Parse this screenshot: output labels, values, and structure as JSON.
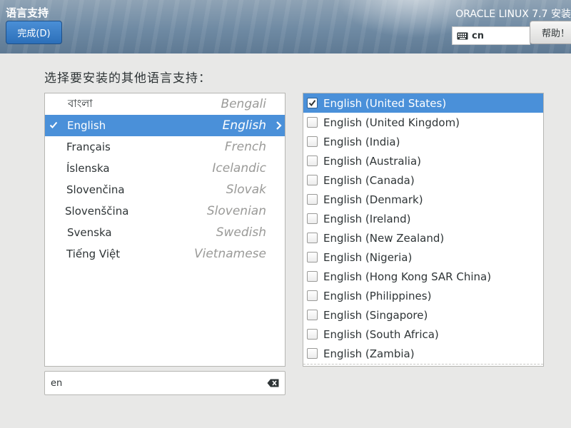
{
  "header": {
    "title": "语言支持",
    "done_label": "完成(D)",
    "product": "ORACLE LINUX 7.7 安装",
    "keyboard_layout": "cn",
    "help_label": "帮助！"
  },
  "prompt": "选择要安装的其他语言支持：",
  "languages": [
    {
      "native": "বাংলা",
      "english": "Bengali"
    },
    {
      "native": "English",
      "english": "English"
    },
    {
      "native": "Français",
      "english": "French"
    },
    {
      "native": "Íslenska",
      "english": "Icelandic"
    },
    {
      "native": "Slovenčina",
      "english": "Slovak"
    },
    {
      "native": "Slovenščina",
      "english": "Slovenian"
    },
    {
      "native": "Svenska",
      "english": "Swedish"
    },
    {
      "native": "Tiếng Việt",
      "english": "Vietnamese"
    }
  ],
  "selected_language": "English",
  "search": {
    "value": "en"
  },
  "locales": [
    {
      "label": "English (United States)",
      "checked": true
    },
    {
      "label": "English (United Kingdom)",
      "checked": false
    },
    {
      "label": "English (India)",
      "checked": false
    },
    {
      "label": "English (Australia)",
      "checked": false
    },
    {
      "label": "English (Canada)",
      "checked": false
    },
    {
      "label": "English (Denmark)",
      "checked": false
    },
    {
      "label": "English (Ireland)",
      "checked": false
    },
    {
      "label": "English (New Zealand)",
      "checked": false
    },
    {
      "label": "English (Nigeria)",
      "checked": false
    },
    {
      "label": "English (Hong Kong SAR China)",
      "checked": false
    },
    {
      "label": "English (Philippines)",
      "checked": false
    },
    {
      "label": "English (Singapore)",
      "checked": false
    },
    {
      "label": "English (South Africa)",
      "checked": false
    },
    {
      "label": "English (Zambia)",
      "checked": false
    }
  ],
  "colors": {
    "selection": "#4a90d9",
    "done_button": "#2c6fb9",
    "header": "#6f8aa3"
  },
  "icons": {
    "keyboard": "keyboard-icon",
    "check": "checkmark-icon",
    "arrow": "chevron-right-icon",
    "clear": "backspace-clear-icon"
  }
}
